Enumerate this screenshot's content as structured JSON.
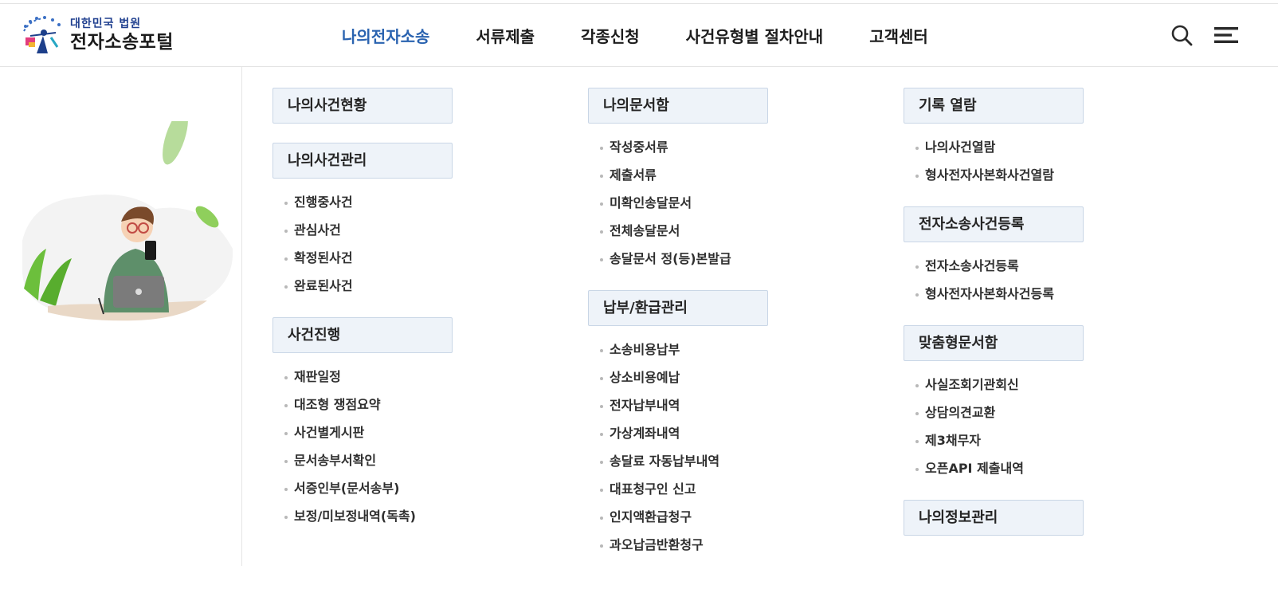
{
  "logo": {
    "sub": "대한민국 법원",
    "main": "전자소송포털",
    "icon": "court-emblem-icon"
  },
  "nav": [
    {
      "label": "나의전자소송",
      "active": true
    },
    {
      "label": "서류제출",
      "active": false
    },
    {
      "label": "각종신청",
      "active": false
    },
    {
      "label": "사건유형별 절차안내",
      "active": false
    },
    {
      "label": "고객센터",
      "active": false
    }
  ],
  "util": {
    "search_icon": "search-icon",
    "menu_icon": "hamburger-menu-icon"
  },
  "colors": {
    "accent": "#2a63b0",
    "category_bg": "#eef3f9",
    "category_border": "#c9d6e6"
  },
  "columns": [
    {
      "groups": [
        {
          "title": "나의사건현황",
          "items": []
        },
        {
          "title": "나의사건관리",
          "items": [
            "진행중사건",
            "관심사건",
            "확정된사건",
            "완료된사건"
          ]
        },
        {
          "title": "사건진행",
          "items": [
            "재판일정",
            "대조형 쟁점요약",
            "사건별게시판",
            "문서송부서확인",
            "서증인부(문서송부)",
            "보정/미보정내역(독촉)"
          ]
        }
      ]
    },
    {
      "groups": [
        {
          "title": "나의문서함",
          "items": [
            "작성중서류",
            "제출서류",
            "미확인송달문서",
            "전체송달문서",
            "송달문서 정(등)본발급"
          ]
        },
        {
          "title": "납부/환급관리",
          "items": [
            "소송비용납부",
            "상소비용예납",
            "전자납부내역",
            "가상계좌내역",
            "송달료 자동납부내역",
            "대표청구인 신고",
            "인지액환급청구",
            "과오납금반환청구"
          ]
        }
      ]
    },
    {
      "groups": [
        {
          "title": "기록 열람",
          "items": [
            "나의사건열람",
            "형사전자사본화사건열람"
          ]
        },
        {
          "title": "전자소송사건등록",
          "items": [
            "전자소송사건등록",
            "형사전자사본화사건등록"
          ]
        },
        {
          "title": "맞춤형문서함",
          "items": [
            "사실조회기관회신",
            "상담의견교환",
            "제3채무자",
            "오픈API 제출내역"
          ]
        },
        {
          "title": "나의정보관리",
          "items": []
        }
      ]
    }
  ]
}
